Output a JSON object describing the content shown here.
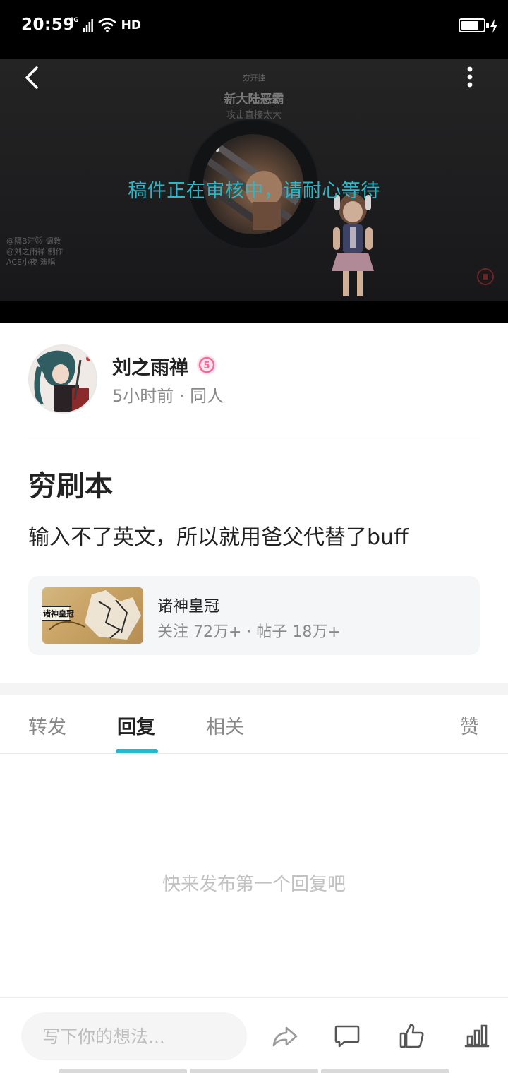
{
  "status_bar": {
    "time": "20:59",
    "network": "4G",
    "hd": "HD",
    "battery_level": 0.7
  },
  "video": {
    "song_top": "穷开挂",
    "song_title": "新大陆恶霸",
    "song_sub": "攻击直接太大",
    "credits": [
      "@隔B汪🐱 调教",
      "@刘之雨禅 制作",
      "ACE小夜 演唱"
    ],
    "review_message": "稿件正在审核中，请耐心等待"
  },
  "author": {
    "name": "刘之雨禅",
    "meta": "5小时前 · 同人",
    "level_badge_color": "#f06b9b"
  },
  "post": {
    "title": "穷刷本",
    "body": "输入不了英文，所以就用爸父代替了buff"
  },
  "topic": {
    "name": "诸神皇冠",
    "stats": "关注 72万+ · 帖子 18万+",
    "thumb_text": "诸神皇冠"
  },
  "tabs": [
    {
      "label": "转发",
      "active": false
    },
    {
      "label": "回复",
      "active": true
    },
    {
      "label": "相关",
      "active": false
    },
    {
      "label": "赞",
      "active": false
    }
  ],
  "empty_state": "快来发布第一个回复吧",
  "bottom_bar": {
    "input_placeholder": "写下你的想法...",
    "icons": [
      "share-icon",
      "comment-icon",
      "like-icon",
      "stats-icon"
    ]
  },
  "colors": {
    "accent": "#2bb7c7",
    "text_primary": "#222222",
    "text_secondary": "#8a8a8a",
    "placeholder": "#bdbdbd"
  }
}
